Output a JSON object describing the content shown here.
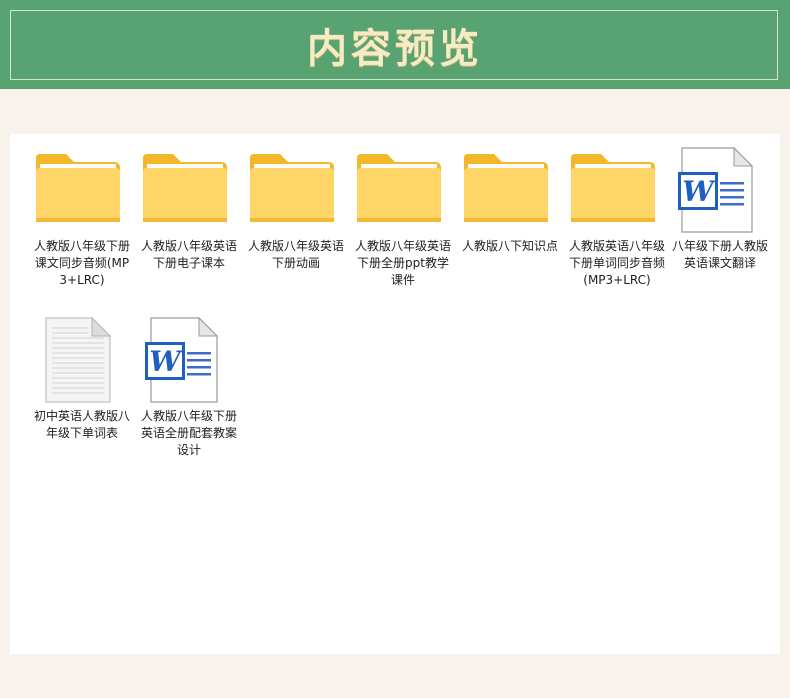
{
  "header": {
    "title": "内容预览"
  },
  "files": [
    {
      "name": "人教版八年级下册课文同步音频(MP3+LRC)",
      "type": "folder"
    },
    {
      "name": "人教版八年级英语下册电子课本",
      "type": "folder"
    },
    {
      "name": "人教版八年级英语下册动画",
      "type": "folder"
    },
    {
      "name": "人教版八年级英语下册全册ppt教学课件",
      "type": "folder"
    },
    {
      "name": "人教版八下知识点",
      "type": "folder"
    },
    {
      "name": "人教版英语八年级下册单词同步音频(MP3+LRC)",
      "type": "folder"
    },
    {
      "name": "八年级下册人教版英语课文翻译",
      "type": "word-document"
    },
    {
      "name": "初中英语人教版八年级下单词表",
      "type": "text-document"
    },
    {
      "name": "人教版八年级下册英语全册配套教案设计",
      "type": "word-document"
    }
  ]
}
